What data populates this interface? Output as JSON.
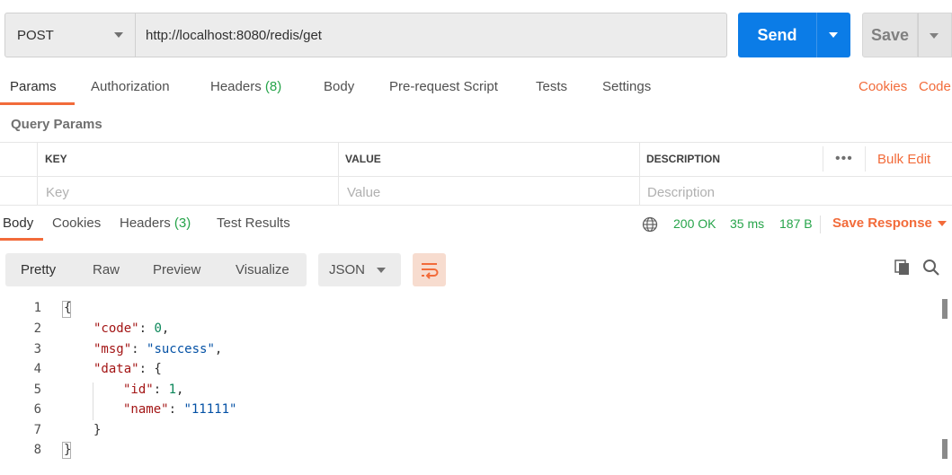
{
  "request": {
    "method": "POST",
    "url": "http://localhost:8080/redis/get",
    "send_label": "Send",
    "save_label": "Save"
  },
  "request_tabs": {
    "params": "Params",
    "authorization": "Authorization",
    "headers": "Headers",
    "headers_count": "(8)",
    "body": "Body",
    "prerequest": "Pre-request Script",
    "tests": "Tests",
    "settings": "Settings",
    "cookies": "Cookies",
    "code": "Code"
  },
  "query_params": {
    "title": "Query Params",
    "columns": {
      "key": "KEY",
      "value": "VALUE",
      "description": "DESCRIPTION"
    },
    "more": "•••",
    "bulk_edit": "Bulk Edit",
    "placeholders": {
      "key": "Key",
      "value": "Value",
      "description": "Description"
    }
  },
  "response_tabs": {
    "body": "Body",
    "cookies": "Cookies",
    "headers": "Headers",
    "headers_count": "(3)",
    "test_results": "Test Results"
  },
  "response_meta": {
    "status": "200 OK",
    "time": "35 ms",
    "size": "187 B",
    "save_response": "Save Response"
  },
  "view": {
    "pretty": "Pretty",
    "raw": "Raw",
    "preview": "Preview",
    "visualize": "Visualize",
    "format": "JSON"
  },
  "code": {
    "line_numbers": [
      "1",
      "2",
      "3",
      "4",
      "5",
      "6",
      "7",
      "8"
    ],
    "open_brace": "{",
    "code_key": "\"code\"",
    "code_val": "0",
    "msg_key": "\"msg\"",
    "msg_val": "\"success\"",
    "data_key": "\"data\"",
    "id_key": "\"id\"",
    "id_val": "1",
    "name_key": "\"name\"",
    "name_val": "\"11111\"",
    "close_inner": "}",
    "close_brace": "}"
  },
  "colors": {
    "accent": "#f26b3a",
    "send": "#0b7ce7",
    "success": "#26a44a"
  }
}
